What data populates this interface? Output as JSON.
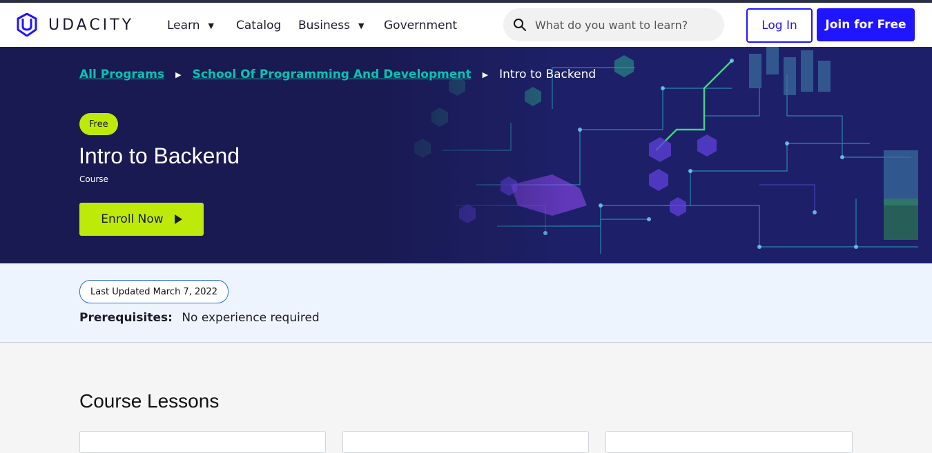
{
  "header": {
    "brand": "UDACITY",
    "nav": [
      {
        "label": "Learn",
        "has_dropdown": true
      },
      {
        "label": "Catalog",
        "has_dropdown": false
      },
      {
        "label": "Business",
        "has_dropdown": true
      },
      {
        "label": "Government",
        "has_dropdown": false
      }
    ],
    "search": {
      "placeholder": "What do you want to learn?",
      "value": ""
    },
    "login_label": "Log In",
    "join_label": "Join for Free"
  },
  "hero": {
    "breadcrumb": [
      {
        "label": "All Programs",
        "link": true
      },
      {
        "label": "School Of Programming And Development",
        "link": true
      },
      {
        "label": "Intro to Backend",
        "link": false
      }
    ],
    "badge": "Free",
    "title": "Intro to Backend",
    "subtitle": "Course",
    "enroll_label": "Enroll Now"
  },
  "meta": {
    "updated": "Last Updated March 7, 2022",
    "prereq_label": "Prerequisites:",
    "prereq_value": "No experience required"
  },
  "lessons": {
    "title": "Course Lessons"
  },
  "colors": {
    "brand_blue": "#2015ff",
    "hero_bg": "#191a52",
    "accent_lime": "#bdea09",
    "link_teal": "#02c5b3"
  },
  "icons": [
    "udacity-logo-icon",
    "chevron-down-icon",
    "search-icon",
    "breadcrumb-arrow-icon",
    "play-icon"
  ]
}
